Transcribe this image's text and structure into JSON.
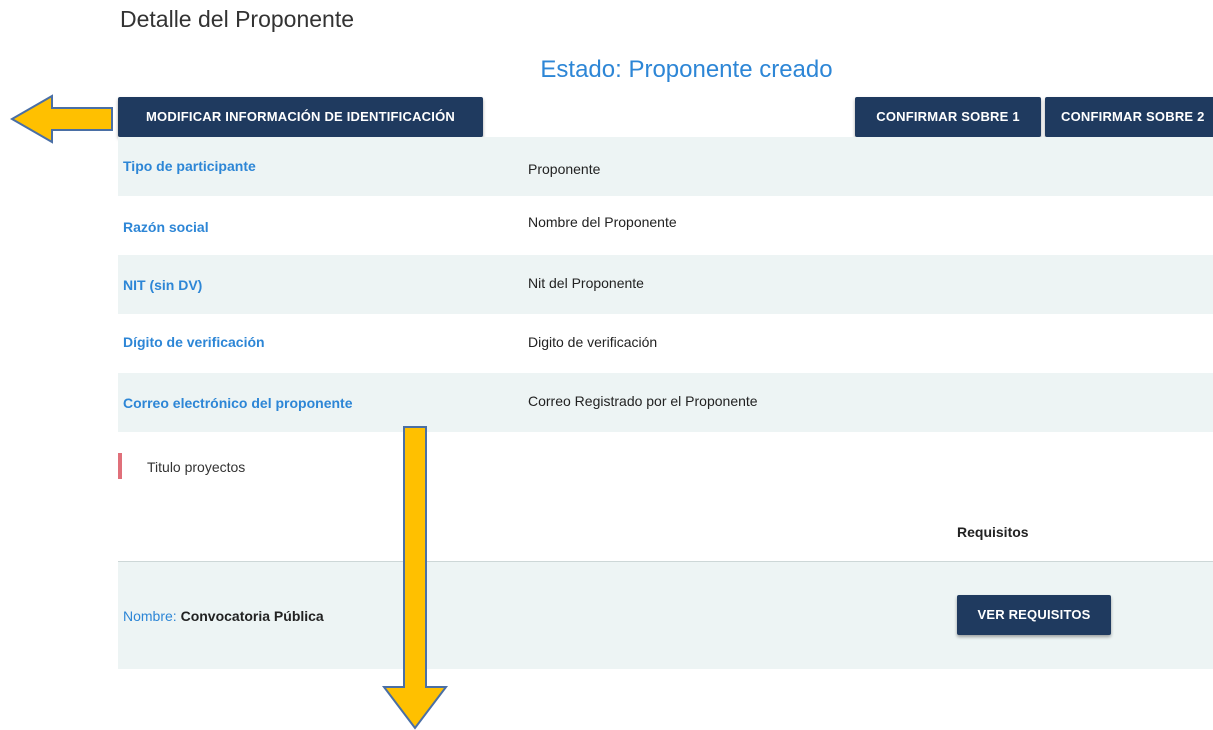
{
  "page": {
    "title": "Detalle del Proponente",
    "status": "Estado: Proponente creado"
  },
  "actions": {
    "modify_label": "MODIFICAR INFORMACIÓN DE IDENTIFICACIÓN",
    "confirm_sobre1_label": "CONFIRMAR SOBRE 1",
    "confirm_sobre2_label": "CONFIRMAR SOBRE 2"
  },
  "details": [
    {
      "label": "Tipo de participante",
      "value": "Proponente"
    },
    {
      "label": "Razón social",
      "value": "Nombre del Proponente"
    },
    {
      "label": "NIT (sin DV)",
      "value": "Nit del Proponente"
    },
    {
      "label": "Dígito de verificación",
      "value": "Digito de verificación"
    },
    {
      "label": "Correo electrónico del proponente",
      "value": "Correo Registrado por el Proponente"
    }
  ],
  "projects": {
    "section_title": "Titulo proyectos",
    "requirements_header": "Requisitos",
    "name_key": "Nombre:",
    "name_value": "Convocatoria Pública",
    "view_requirements_label": "VER REQUISITOS"
  },
  "colors": {
    "primary_button": "#1f3a5f",
    "accent_text": "#2d86d6",
    "row_shade": "#edf4f4",
    "arrow_fill": "#ffc000",
    "arrow_stroke": "#4a6fa5",
    "section_marker": "#e0707a"
  }
}
